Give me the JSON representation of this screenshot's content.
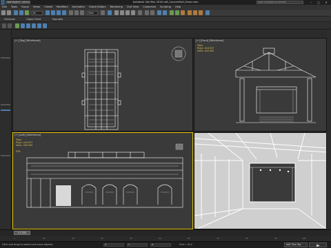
{
  "titlebar": {
    "workspace": "Workspace: Default",
    "title": "Autodesk 3ds Max 2016    Loft_ConcertHall_Smax.max",
    "search_placeholder": "Type a keyword or phrase",
    "minimize": "–",
    "maximize": "□",
    "close": "✕"
  },
  "menus": [
    "Edit",
    "Tools",
    "Group",
    "Views",
    "Create",
    "Modifiers",
    "Animation",
    "Graph Editors",
    "Rendering",
    "Civil View",
    "Customize",
    "Scripting",
    "Help"
  ],
  "toolbar": {
    "selection_filter": "All",
    "view_dropdown": "View"
  },
  "ribbon": {
    "tabs": [
      "Selection",
      "Object Paint",
      "Populate"
    ]
  },
  "viewports": {
    "top": {
      "label": "[+] [Top] [Wireframe]"
    },
    "front": {
      "label": "[+] [Front] [Wireframe]"
    },
    "left": {
      "label": "[+] [Left] [Wireframe]"
    },
    "perspective": {
      "label": ""
    },
    "stats": {
      "title": "Total",
      "polys_label": "Polys:",
      "polys": "418 037",
      "verts_label": "Verts:",
      "verts": "449 095",
      "fps_label": "FPS:"
    }
  },
  "timeline": {
    "slider": "0 / 100",
    "ticks": [
      "0",
      "10",
      "20",
      "30",
      "40",
      "50",
      "60",
      "70",
      "80",
      "90",
      "100"
    ]
  },
  "statusbar": {
    "status": "Click and drag to select and move objects",
    "x_label": "X:",
    "y_label": "Y:",
    "z_label": "Z:",
    "grid": "Grid = 10,0",
    "add_time_tag": "Add Time Tag"
  },
  "colors": {
    "accent_active_viewport": "#e3c200",
    "wire": "#ffffff",
    "stats": "#e3c24a"
  }
}
